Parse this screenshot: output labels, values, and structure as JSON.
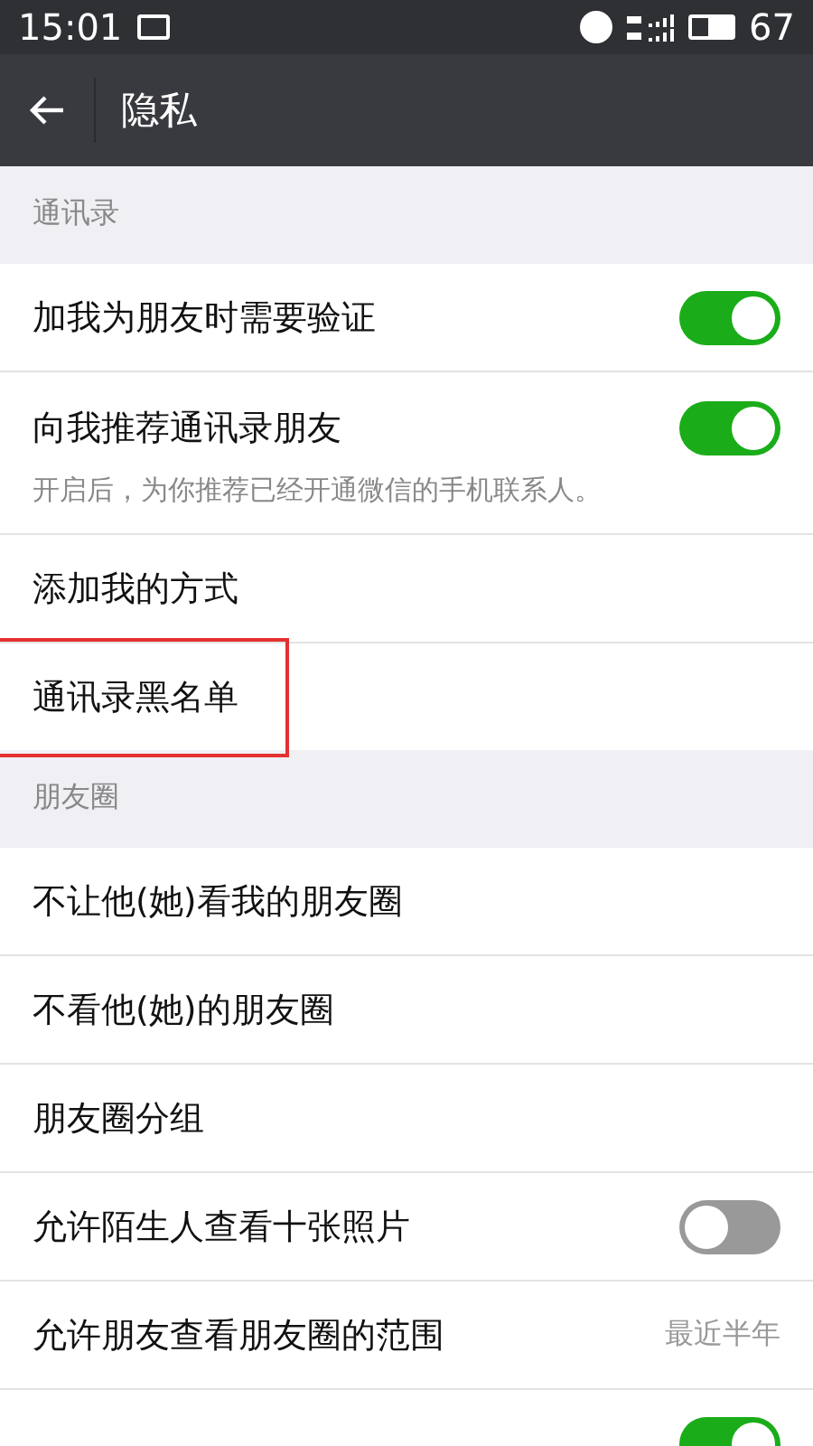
{
  "status_bar": {
    "time": "15:01",
    "battery": "67"
  },
  "header": {
    "title": "隐私"
  },
  "sections": [
    {
      "title": "通讯录",
      "items": [
        {
          "kind": "toggle",
          "label": "加我为朋友时需要验证",
          "on": true
        },
        {
          "kind": "toggle",
          "label": "向我推荐通讯录朋友",
          "on": true,
          "description": "开启后，为你推荐已经开通微信的手机联系人。"
        },
        {
          "kind": "link",
          "label": "添加我的方式"
        },
        {
          "kind": "link",
          "label": "通讯录黑名单",
          "highlighted": true
        }
      ]
    },
    {
      "title": "朋友圈",
      "items": [
        {
          "kind": "link",
          "label": "不让他(她)看我的朋友圈"
        },
        {
          "kind": "link",
          "label": "不看他(她)的朋友圈"
        },
        {
          "kind": "link",
          "label": "朋友圈分组"
        },
        {
          "kind": "toggle",
          "label": "允许陌生人查看十张照片",
          "on": false
        },
        {
          "kind": "value",
          "label": "允许朋友查看朋友圈的范围",
          "value": "最近半年"
        },
        {
          "kind": "toggle",
          "on": true
        }
      ]
    }
  ]
}
